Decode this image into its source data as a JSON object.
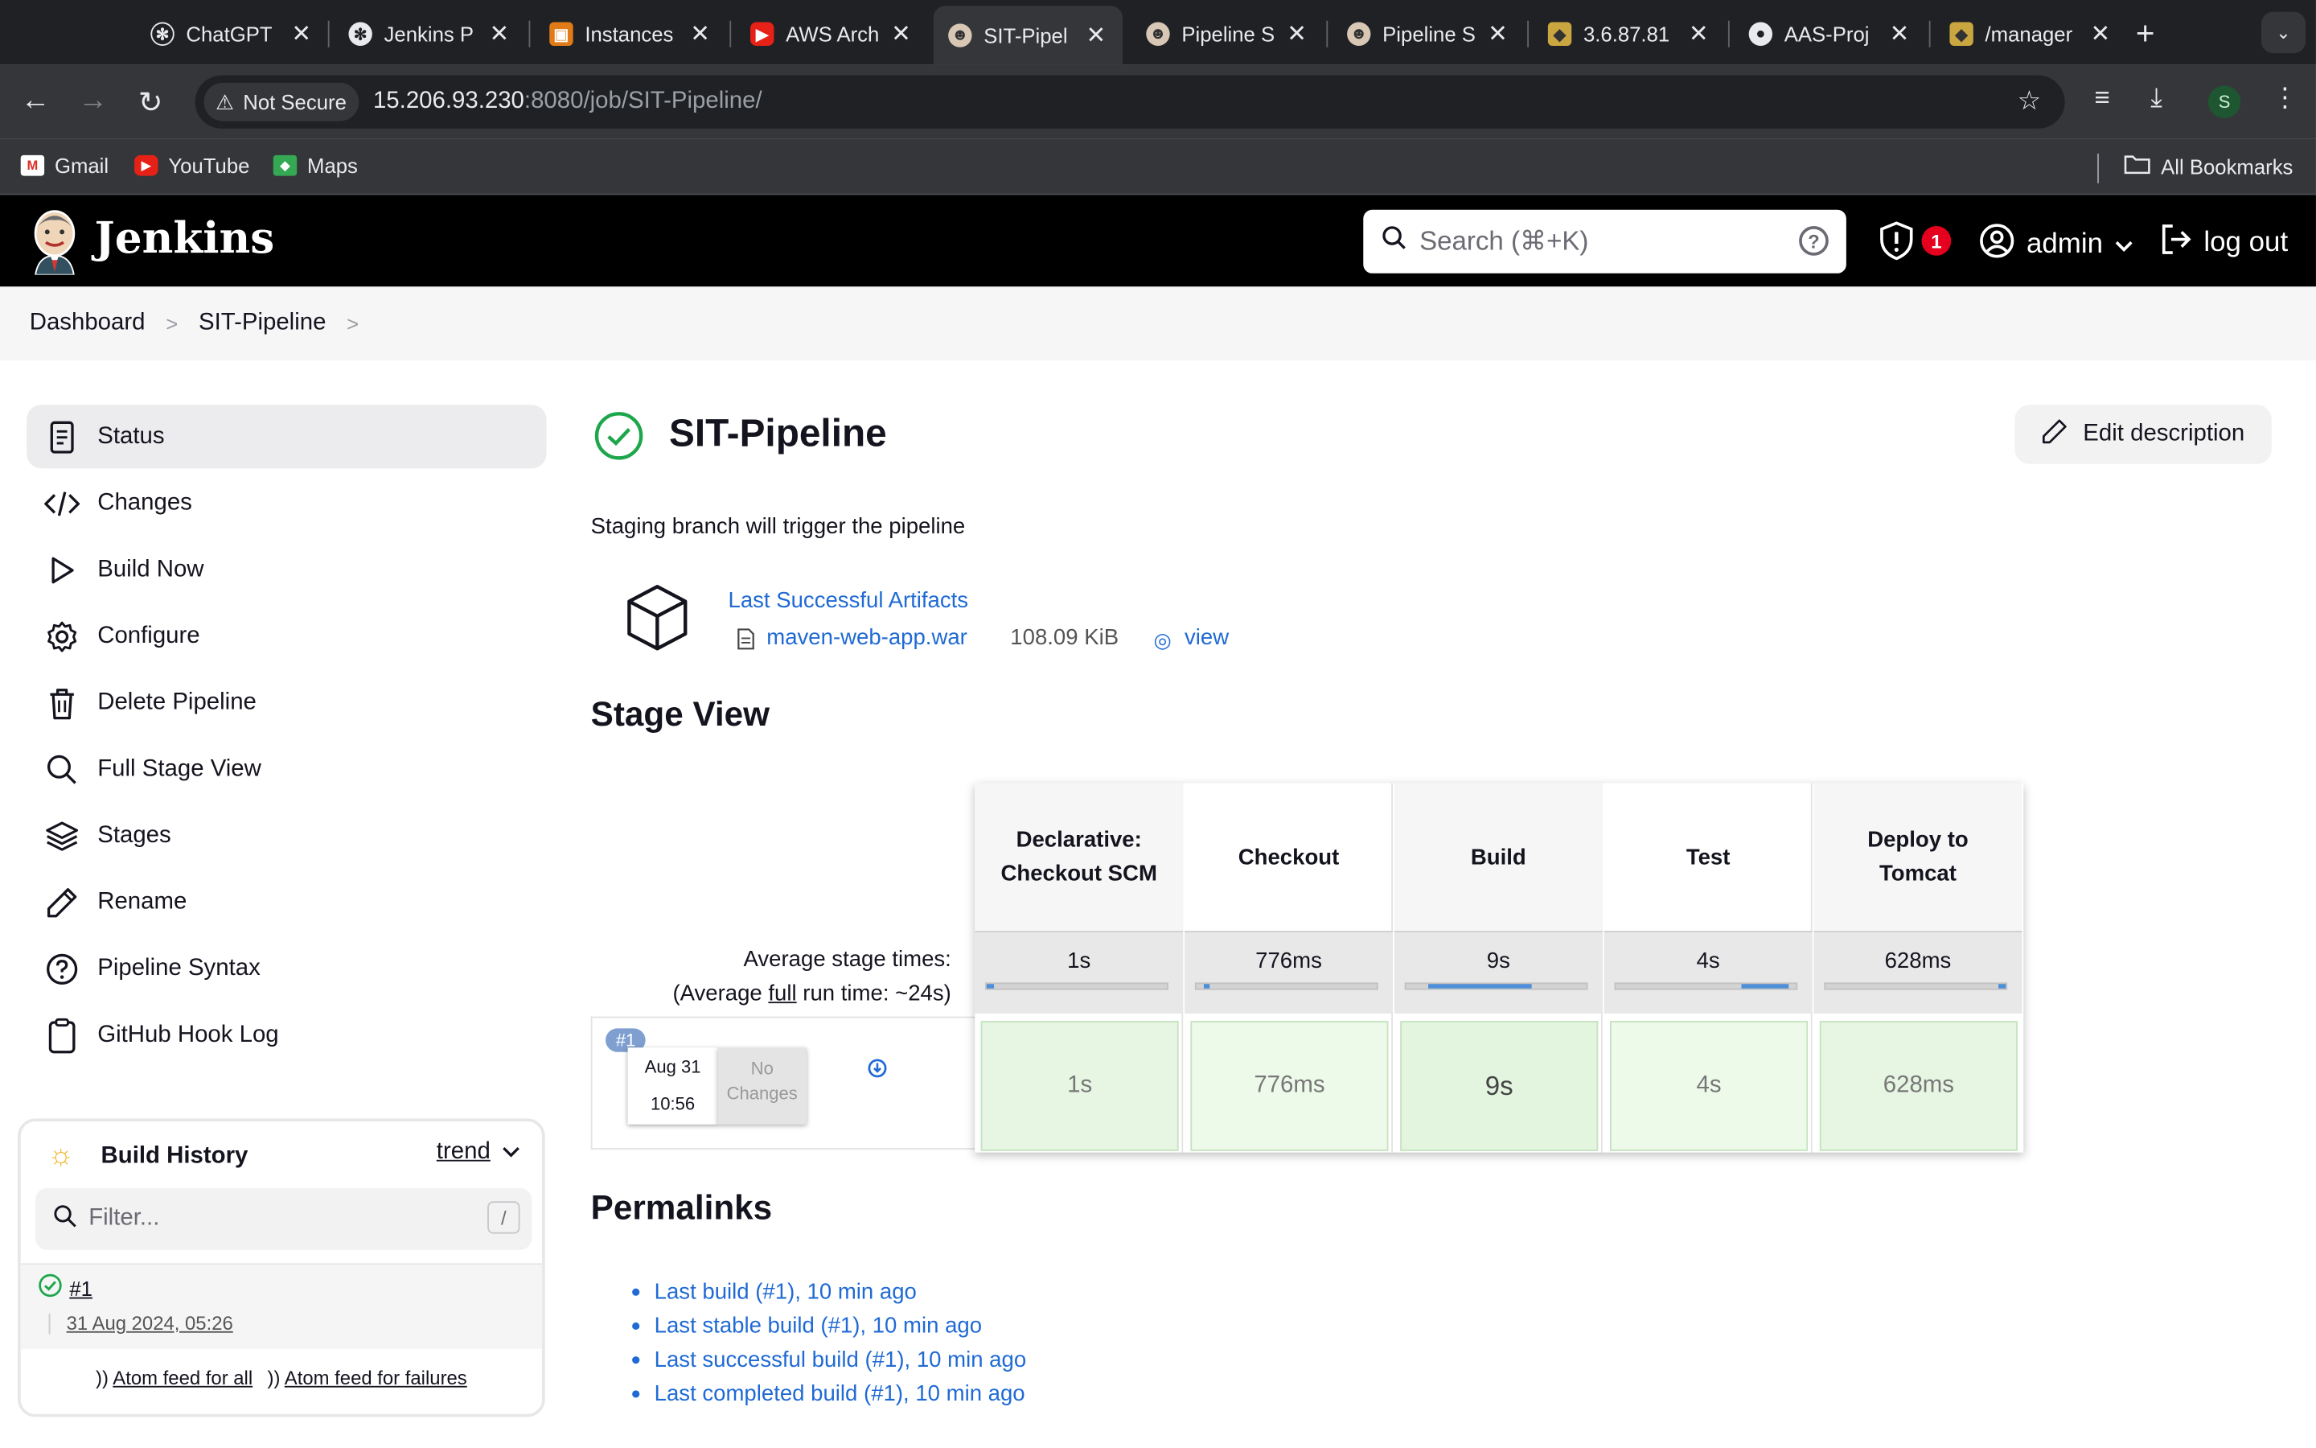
{
  "browser": {
    "tabs": [
      {
        "title": "ChatGPT"
      },
      {
        "title": "Jenkins P"
      },
      {
        "title": "Instances"
      },
      {
        "title": "AWS Arch"
      },
      {
        "title": "SIT-Pipel"
      },
      {
        "title": "Pipeline S"
      },
      {
        "title": "Pipeline S"
      },
      {
        "title": "3.6.87.81"
      },
      {
        "title": "AAS-Proj"
      },
      {
        "title": "/manager"
      }
    ],
    "security_label": "Not Secure",
    "url_host": "15.206.93.230",
    "url_rest": ":8080/job/SIT-Pipeline/",
    "profile_initial": "S",
    "bookmarks": [
      {
        "label": "Gmail"
      },
      {
        "label": "YouTube"
      },
      {
        "label": "Maps"
      }
    ],
    "all_bookmarks": "All Bookmarks"
  },
  "header": {
    "app_name": "Jenkins",
    "search_placeholder": "Search (⌘+K)",
    "security_count": "1",
    "user": "admin",
    "logout": "log out"
  },
  "breadcrumb": {
    "items": [
      "Dashboard",
      "SIT-Pipeline"
    ]
  },
  "sidebar": {
    "tasks": [
      {
        "label": "Status",
        "icon": "document-icon"
      },
      {
        "label": "Changes",
        "icon": "code-icon"
      },
      {
        "label": "Build Now",
        "icon": "play-icon"
      },
      {
        "label": "Configure",
        "icon": "gear-icon"
      },
      {
        "label": "Delete Pipeline",
        "icon": "trash-icon"
      },
      {
        "label": "Full Stage View",
        "icon": "search-icon"
      },
      {
        "label": "Stages",
        "icon": "layers-icon"
      },
      {
        "label": "Rename",
        "icon": "pencil-icon"
      },
      {
        "label": "Pipeline Syntax",
        "icon": "help-circle-icon"
      },
      {
        "label": "GitHub Hook Log",
        "icon": "clipboard-icon"
      }
    ],
    "build_history": {
      "title": "Build History",
      "trend": "trend",
      "filter_placeholder": "Filter...",
      "filter_shortcut": "/",
      "builds": [
        {
          "number": "#1",
          "date": "31 Aug 2024, 05:26"
        }
      ],
      "feed_all": "Atom feed for all",
      "feed_failures": "Atom feed for failures"
    }
  },
  "main": {
    "title": "SIT-Pipeline",
    "edit_description": "Edit description",
    "description": "Staging branch will trigger the pipeline",
    "artifacts": {
      "title": "Last Successful Artifacts",
      "file": "maven-web-app.war",
      "size": "108.09 KiB",
      "view": "view"
    },
    "stage_view": {
      "heading": "Stage View",
      "avg_label": "Average stage times:",
      "avg_full_prefix": "(Average ",
      "avg_full_word": "full",
      "avg_full_suffix": " run time: ~24s)",
      "stages": [
        {
          "name": "Declarative: Checkout SCM",
          "avg": "1s",
          "bar_start": 0.0,
          "bar_fraction": 0.04
        },
        {
          "name": "Checkout",
          "avg": "776ms",
          "bar_start": 0.04,
          "bar_fraction": 0.03
        },
        {
          "name": "Build",
          "avg": "9s",
          "bar_start": 0.12,
          "bar_fraction": 0.58
        },
        {
          "name": "Test",
          "avg": "4s",
          "bar_start": 0.7,
          "bar_fraction": 0.26
        },
        {
          "name": "Deploy to Tomcat",
          "avg": "628ms",
          "bar_start": 0.96,
          "bar_fraction": 0.04
        }
      ],
      "run": {
        "number": "#1",
        "date": "Aug 31",
        "time": "10:56",
        "changes": "No Changes",
        "durations": [
          "1s",
          "776ms",
          "9s",
          "4s",
          "628ms"
        ]
      }
    },
    "permalinks": {
      "heading": "Permalinks",
      "links": [
        "Last build (#1), 10 min ago",
        "Last stable build (#1), 10 min ago",
        "Last successful build (#1), 10 min ago",
        "Last completed build (#1), 10 min ago"
      ]
    }
  }
}
